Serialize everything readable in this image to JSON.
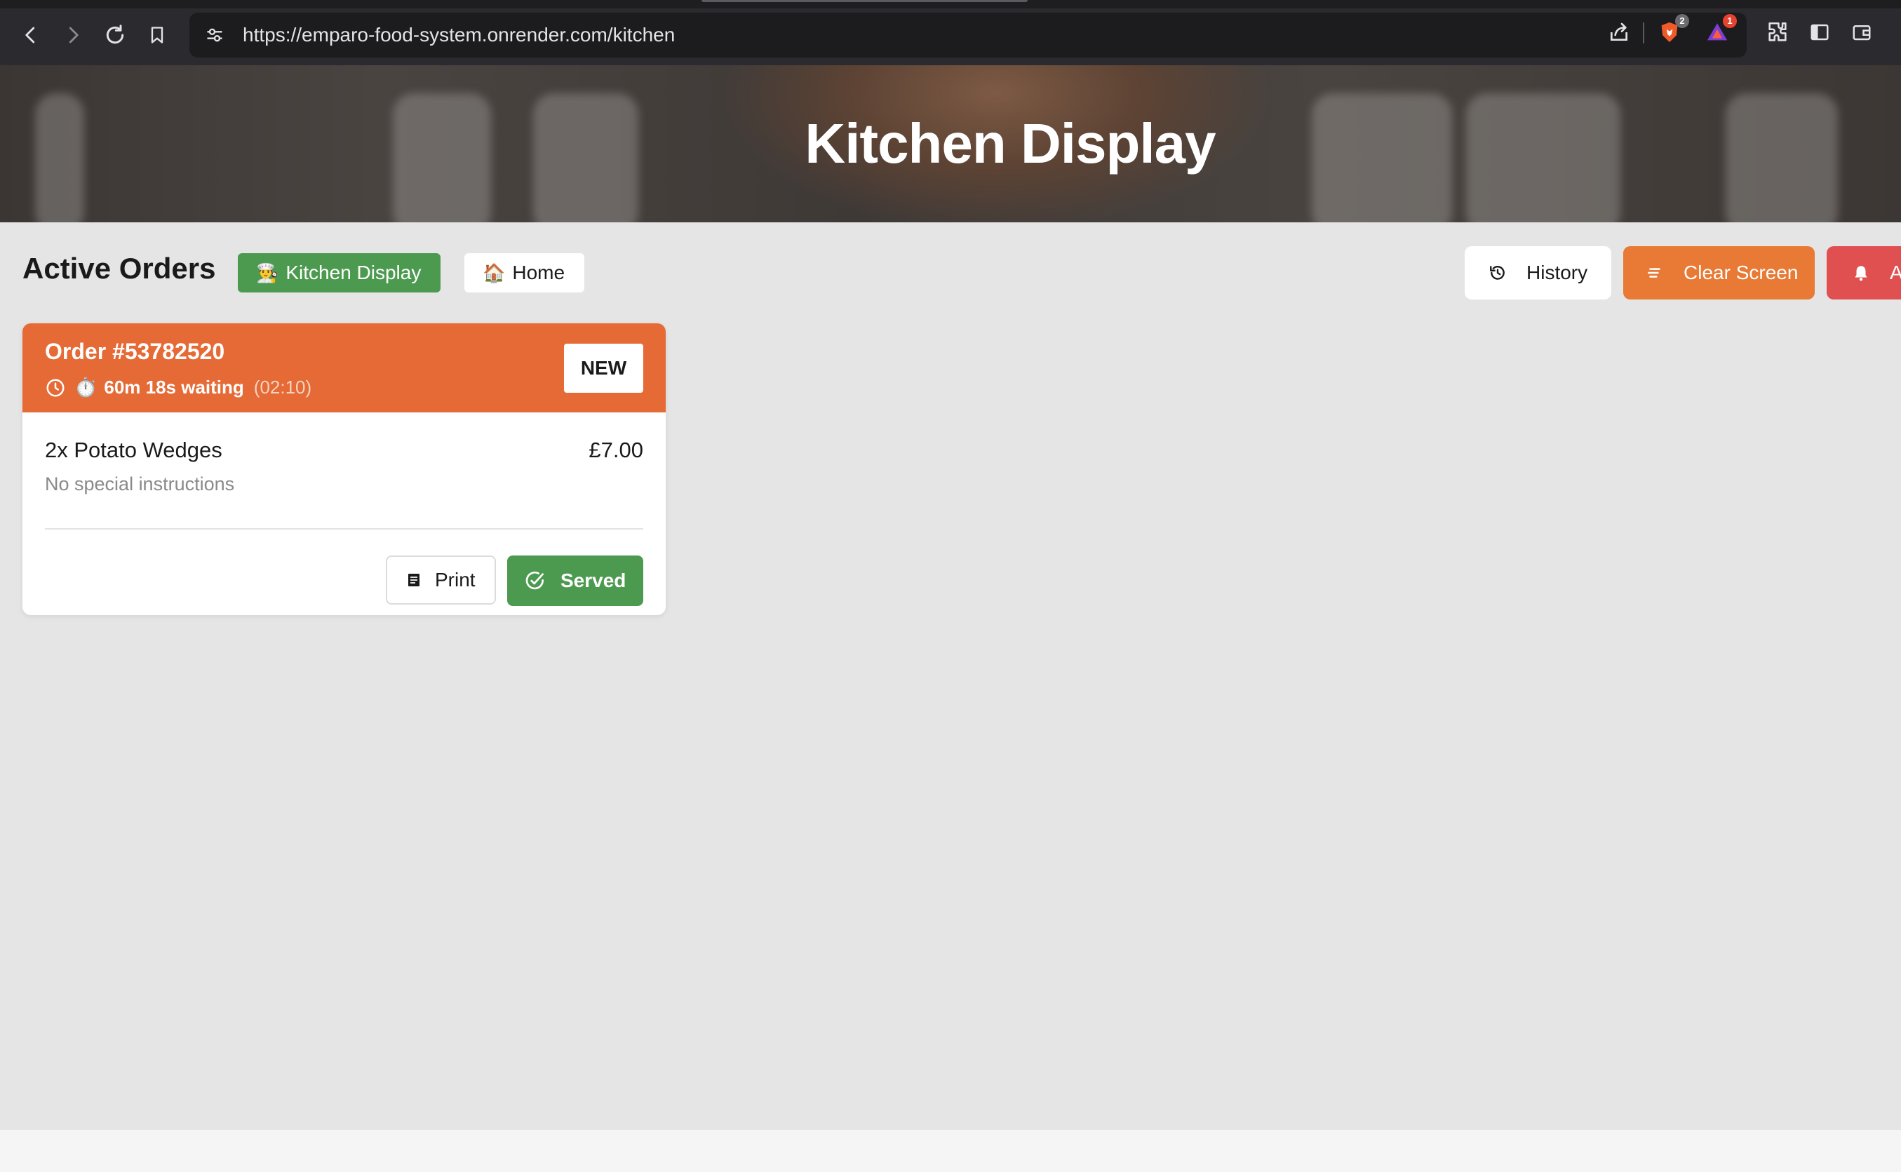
{
  "browser": {
    "url": "https://emparo-food-system.onrender.com/kitchen",
    "brave_shield_count": "2",
    "rewards_count": "1",
    "icons": [
      "back-icon",
      "forward-icon",
      "reload-icon",
      "bookmark-icon",
      "site-settings-icon",
      "share-icon",
      "brave-shield-icon",
      "brave-rewards-icon",
      "extensions-icon",
      "sidebar-icon",
      "wallet-icon"
    ]
  },
  "hero": {
    "title": "Kitchen Display"
  },
  "header": {
    "title": "Active Orders",
    "kitchen_display_label": "Kitchen Display",
    "kitchen_display_emoji": "👨‍🍳",
    "home_label": "Home",
    "home_emoji": "🏠",
    "history_label": "History",
    "clear_screen_label": "Clear Screen",
    "alert_label": "Al"
  },
  "orders": [
    {
      "number": "Order #53782520",
      "status": "NEW",
      "waiting": "60m 18s waiting",
      "time": "(02:10)",
      "timer_emoji": "⏱️",
      "items": [
        {
          "name": "2x Potato Wedges",
          "price": "£7.00",
          "note": "No special instructions"
        }
      ],
      "print_label": "Print",
      "served_label": "Served"
    }
  ],
  "colors": {
    "accent_orange": "#e56a35",
    "clear_orange": "#e87a35",
    "green": "#4c9a4f",
    "alert_red": "#e05050",
    "background": "#e5e5e5"
  }
}
